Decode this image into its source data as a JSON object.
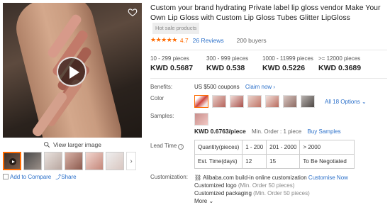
{
  "gallery": {
    "view_larger": "View larger image",
    "add_to_compare": "Add to Compare",
    "share": "Share"
  },
  "product": {
    "title": "Custom your brand hydrating Private label lip gloss vendor Make Your Own Lip Gloss with Custom Lip Gloss Tubes Glitter LipGloss",
    "hot_badge": "Hot sale products",
    "rating": "4.7",
    "reviews": "26 Reviews",
    "buyers": "200 buyers"
  },
  "price_tiers": [
    {
      "range": "10 - 299 pieces",
      "price": "KWD 0.5687"
    },
    {
      "range": "300 - 999 pieces",
      "price": "KWD 0.538"
    },
    {
      "range": "1000 - 11999 pieces",
      "price": "KWD 0.5226"
    },
    {
      "range": ">= 12000 pieces",
      "price": "KWD 0.3689"
    }
  ],
  "benefits": {
    "label": "Benefits:",
    "text": "US $500 coupons",
    "link": "Claim now ›"
  },
  "color": {
    "label": "Color",
    "all_options": "All 18 Options ⌄"
  },
  "samples": {
    "label": "Samples:",
    "price": "KWD 0.6763/piece",
    "min_order": "Min. Order : 1 piece",
    "buy_link": "Buy Samples"
  },
  "lead_time": {
    "label": "Lead Time",
    "info": "i",
    "rows": [
      [
        "Quantity(pieces)",
        "1 - 200",
        "201 - 2000",
        "> 2000"
      ],
      [
        "Est. Time(days)",
        "12",
        "15",
        "To Be Negotiated"
      ]
    ]
  },
  "customization": {
    "label": "Customization:",
    "headline_prefix": "Alibaba.com build-in online customization",
    "headline_link": "Customise Now",
    "logo": "Customized logo",
    "logo_note": "(Min. Order 50 pieces)",
    "packaging": "Customized packaging",
    "packaging_note": "(Min. Order 50 pieces)",
    "more": "More ⌄"
  },
  "colors": {
    "accent": "#ff6a00",
    "link": "#2a6fc9"
  }
}
